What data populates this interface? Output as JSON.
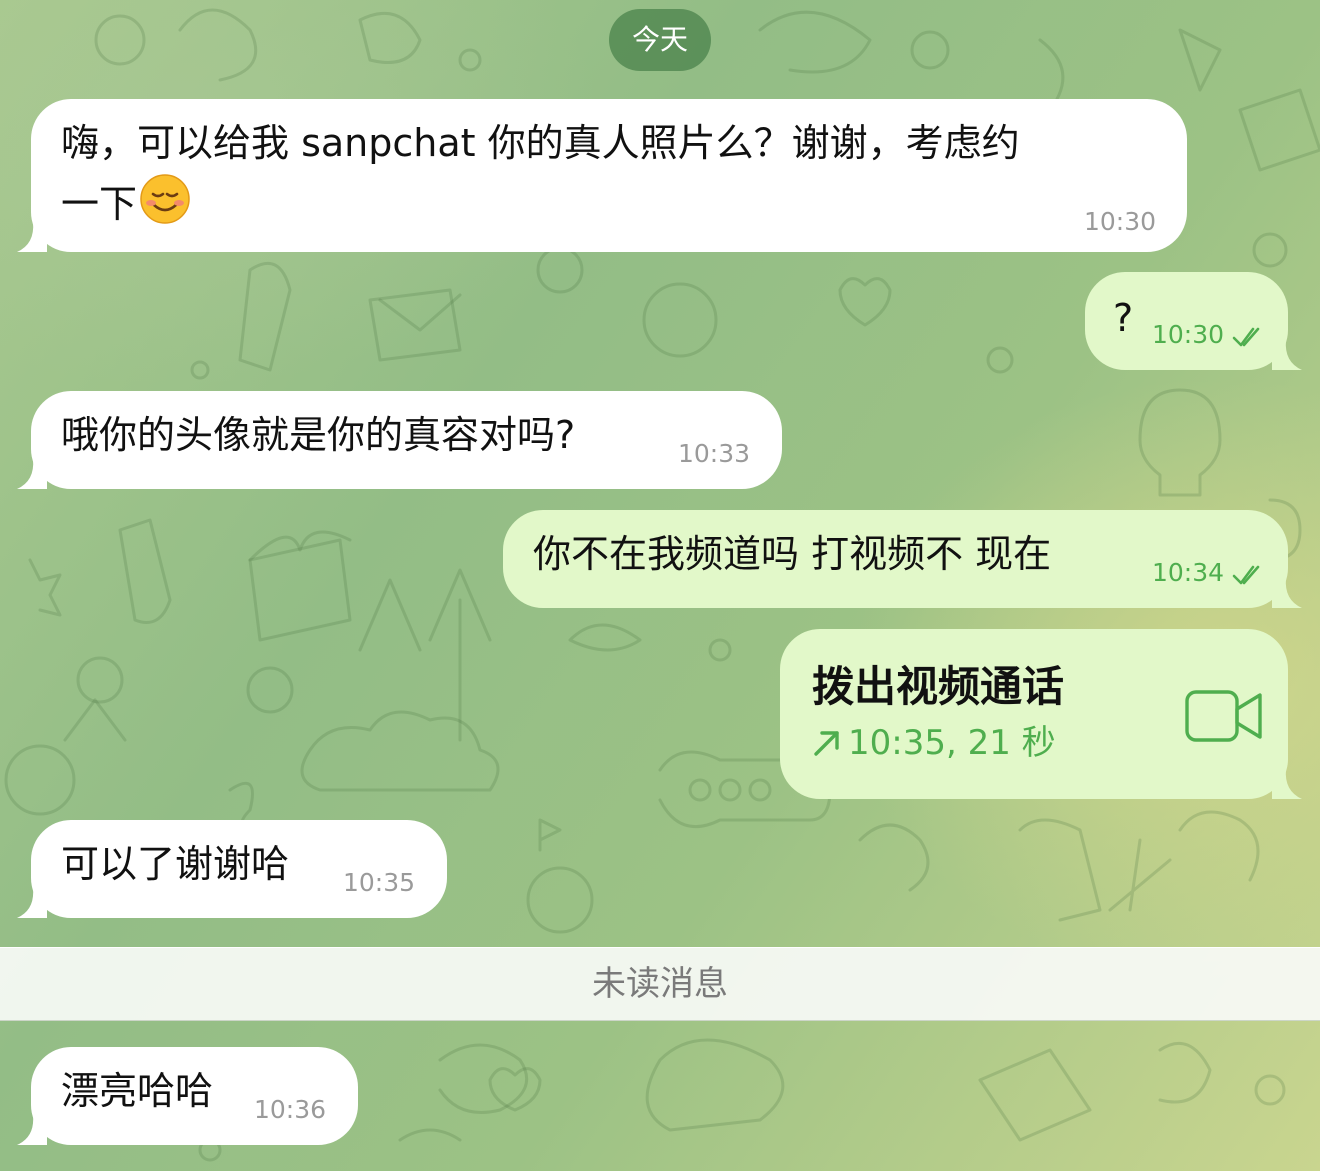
{
  "date_label": "今天",
  "messages": [
    {
      "direction": "in",
      "lines": [
        "嗨，可以给我 sanpchat 你的真人照片么？谢谢，考虑约",
        "一下"
      ],
      "emoji": "smiling-face-emoji",
      "time": "10:30"
    },
    {
      "direction": "out",
      "text": "?",
      "time": "10:30",
      "status": "read"
    },
    {
      "direction": "in",
      "text": "哦你的头像就是你的真容对吗?",
      "time": "10:33"
    },
    {
      "direction": "out",
      "text": "你不在我频道吗 打视频不 现在",
      "time": "10:34",
      "status": "read"
    },
    {
      "direction": "out",
      "type": "call",
      "title": "拨出视频通话",
      "detail": "10:35, 21 秒",
      "icon": "video-camera-icon"
    },
    {
      "direction": "in",
      "text": "可以了谢谢哈",
      "time": "10:35"
    }
  ],
  "unread_label": "未读消息",
  "unread_messages": [
    {
      "direction": "in",
      "text": "漂亮哈哈",
      "time": "10:36"
    }
  ],
  "colors": {
    "incoming_bubble": "#ffffff",
    "outgoing_bubble": "#e2f8c9",
    "accent_green": "#4fae4e",
    "date_pill": "#508750"
  }
}
